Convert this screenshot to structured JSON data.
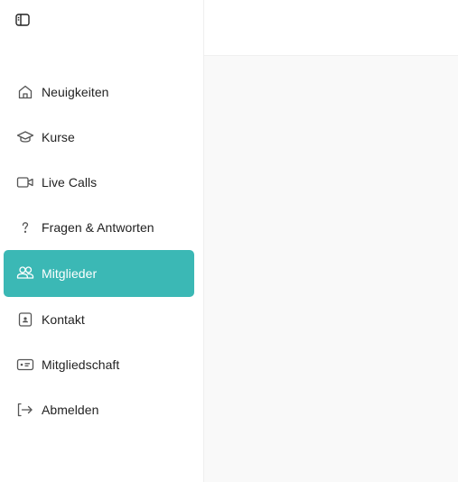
{
  "colors": {
    "accent": "#3bb8b5",
    "text": "#222222",
    "icon": "#555555",
    "content_bg": "#f9f9f9"
  },
  "sidebar": {
    "toggle_icon": "sidebar-toggle-icon",
    "items": [
      {
        "label": "Neuigkeiten",
        "icon": "home-icon",
        "active": false
      },
      {
        "label": "Kurse",
        "icon": "graduation-cap-icon",
        "active": false
      },
      {
        "label": "Live Calls",
        "icon": "video-icon",
        "active": false
      },
      {
        "label": "Fragen & Antworten",
        "icon": "question-mark-icon",
        "active": false
      },
      {
        "label": "Mitglieder",
        "icon": "users-icon",
        "active": true
      },
      {
        "label": "Kontakt",
        "icon": "contact-card-icon",
        "active": false
      },
      {
        "label": "Mitgliedschaft",
        "icon": "id-card-icon",
        "active": false
      },
      {
        "label": "Abmelden",
        "icon": "logout-icon",
        "active": false
      }
    ]
  }
}
